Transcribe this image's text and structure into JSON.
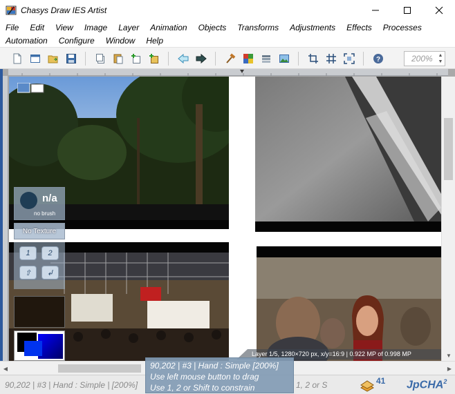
{
  "window": {
    "title": "Chasys Draw IES Artist",
    "minimize_icon": "minimize-icon",
    "maximize_icon": "maximize-icon",
    "close_icon": "close-icon"
  },
  "menu": {
    "row1": [
      "File",
      "Edit",
      "View",
      "Image",
      "Layer",
      "Animation",
      "Objects",
      "Transforms",
      "Adjustments",
      "Effects",
      "Processes"
    ],
    "row2": [
      "Automation",
      "Configure",
      "Window",
      "Help"
    ]
  },
  "toolbar": {
    "zoom_value": "200%",
    "icons": [
      "new-document-icon",
      "new-window-icon",
      "open-icon",
      "save-icon",
      "copy-icon",
      "paste-icon",
      "add-layer-icon",
      "add-layer-copy-icon",
      "back-arrow-icon",
      "forward-arrow-icon",
      "hammer-icon",
      "palette-grid-icon",
      "layers-icon",
      "image-icon",
      "crop-icon",
      "grid-icon",
      "fit-icon",
      "help-icon"
    ]
  },
  "side_panel": {
    "brush_label": "n/a",
    "brush_sub": "no brush",
    "texture_label": "No Texture",
    "buttons": [
      "1",
      "2",
      "⇧",
      "↲"
    ]
  },
  "canvas": {
    "layer_info": "Layer 1/5, 1280×720 px, x/y=16:9 | 0.922 MP of 0.998 MP"
  },
  "status": {
    "left_text": "90,202 | #3 | Hand : Simple | [200%]",
    "right_hint": "1, 2 or S",
    "badge_count": "41",
    "brand": "JpCHA",
    "brand_sup": "2"
  },
  "tooltip": {
    "line1": "90,202 | #3 | Hand : Simple  [200%]",
    "line2": "Use left mouse button to drag",
    "line3": "Use 1, 2 or Shift to constrain"
  },
  "colors": {
    "accent": "#3a6aa8",
    "workspace": "#a9a9a9",
    "toolbar": "#f3f3f3"
  }
}
